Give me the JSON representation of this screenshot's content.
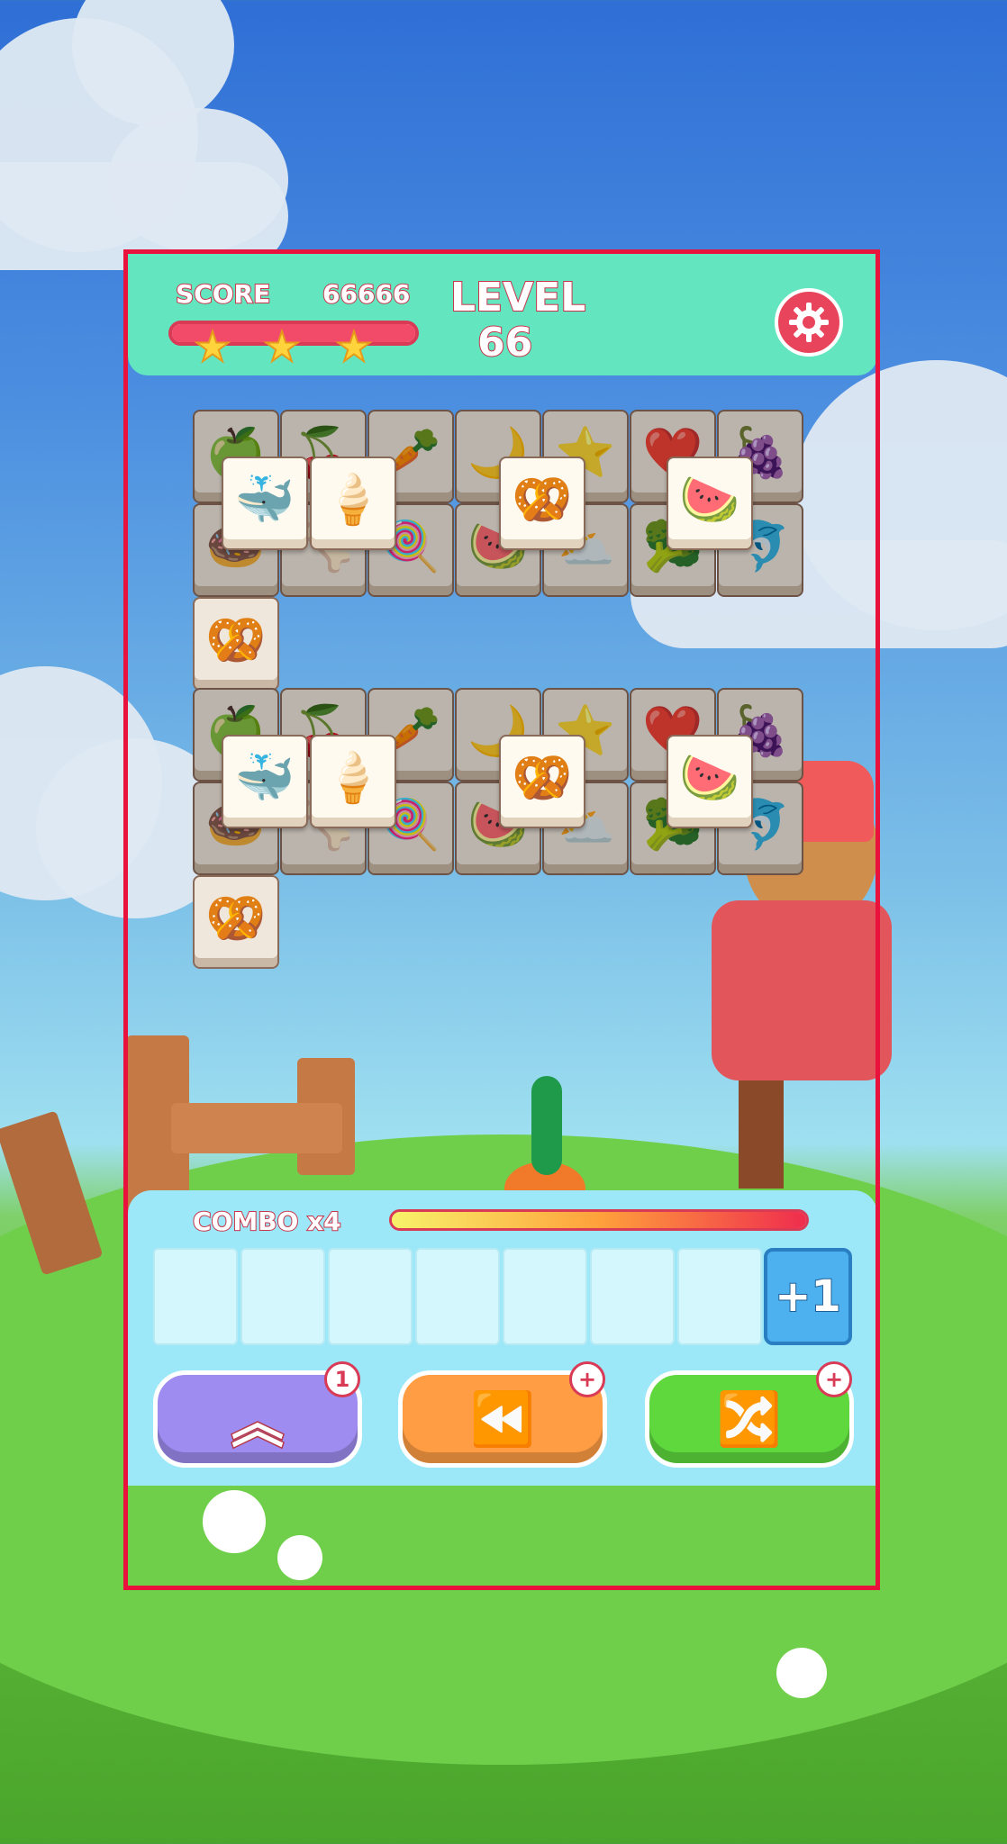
{
  "header": {
    "score_label": "SCORE",
    "score_value": "66666",
    "level_label": "LEVEL",
    "level_value": "66",
    "score_progress": 1.0,
    "stars_earned": 3,
    "star_glyph": "★",
    "settings_icon": "gear-icon"
  },
  "board": {
    "tiles_icons": [
      "apple",
      "cherry",
      "carrot",
      "moon",
      "star",
      "heart",
      "grapes",
      "donut",
      "bone",
      "candy",
      "watermelon",
      "cloud-sun",
      "broccoli",
      "dolphin",
      "ice-cream",
      "pretzel"
    ],
    "top_tiles": [
      "whale",
      "ice-cream",
      "pretzel",
      "watermelon"
    ],
    "glyphs": {
      "apple": "🍏",
      "cherry": "🍒",
      "carrot": "🥕",
      "moon": "🌙",
      "star": "⭐",
      "heart": "❤️",
      "grapes": "🍇",
      "donut": "🍩",
      "bone": "🦴",
      "candy": "🍭",
      "watermelon": "🍉",
      "cloud-sun": "⛅",
      "broccoli": "🥦",
      "dolphin": "🐬",
      "ice-cream": "🍦",
      "pretzel": "🥨",
      "whale": "🐳"
    }
  },
  "footer": {
    "combo_label": "COMBO x4",
    "combo_progress": 1.0,
    "slot_count": 7,
    "extra_slot_label": "+1",
    "buttons": [
      {
        "name": "undo-up-button",
        "icon": "double-chevron-up-icon",
        "glyph": "︽",
        "badge": "1",
        "color": "#9e8cf0"
      },
      {
        "name": "rewind-button",
        "icon": "rewind-icon",
        "glyph": "⏪",
        "badge": "+",
        "color": "#ff9d45"
      },
      {
        "name": "shuffle-button",
        "icon": "shuffle-icon",
        "glyph": "🔀",
        "badge": "+",
        "color": "#5fd83e"
      }
    ]
  },
  "colors": {
    "header_bg": "#63e6c0",
    "frame_border": "#e8123c",
    "panel_bg": "#9ce8f8",
    "accent_red": "#d93a55"
  }
}
